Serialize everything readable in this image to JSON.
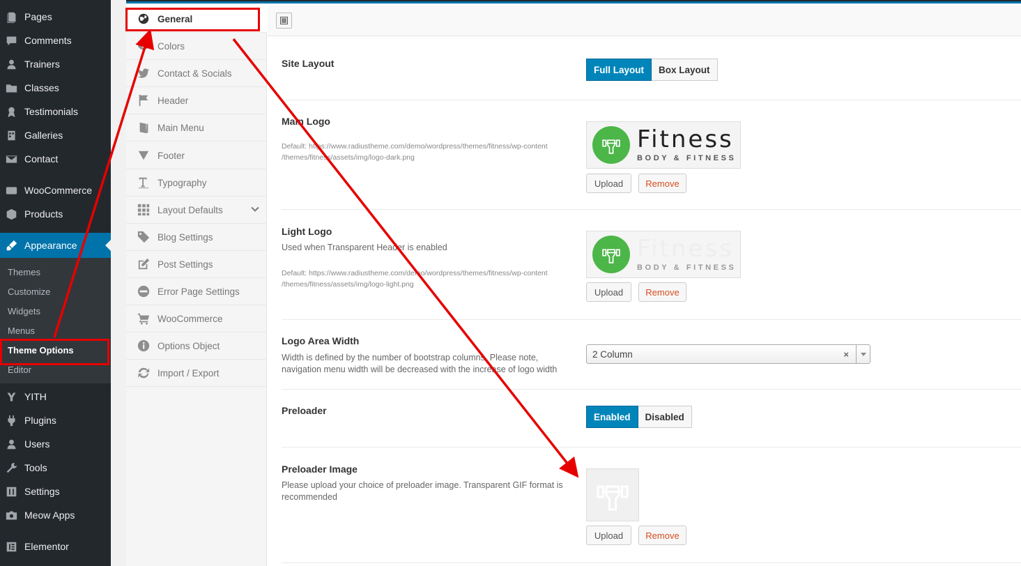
{
  "admin_menu": {
    "items": [
      {
        "label": "Pages",
        "icon": "pages-icon"
      },
      {
        "label": "Comments",
        "icon": "comments-icon"
      },
      {
        "label": "Trainers",
        "icon": "trainers-icon"
      },
      {
        "label": "Classes",
        "icon": "folder-icon"
      },
      {
        "label": "Testimonials",
        "icon": "award-icon"
      },
      {
        "label": "Galleries",
        "icon": "gallery-icon"
      },
      {
        "label": "Contact",
        "icon": "mail-icon"
      },
      {
        "label": "WooCommerce",
        "icon": "woocommerce-icon"
      },
      {
        "label": "Products",
        "icon": "box-icon"
      },
      {
        "label": "Appearance",
        "icon": "brush-icon"
      },
      {
        "label": "YITH",
        "icon": "yith-icon"
      },
      {
        "label": "Plugins",
        "icon": "plugin-icon"
      },
      {
        "label": "Users",
        "icon": "users-icon"
      },
      {
        "label": "Tools",
        "icon": "wrench-icon"
      },
      {
        "label": "Settings",
        "icon": "settings-icon"
      },
      {
        "label": "Meow Apps",
        "icon": "camera-icon"
      },
      {
        "label": "Elementor",
        "icon": "elementor-icon"
      }
    ],
    "appearance_submenu": [
      "Themes",
      "Customize",
      "Widgets",
      "Menus",
      "Theme Options",
      "Editor"
    ],
    "current_item": "Appearance",
    "current_subitem": "Theme Options"
  },
  "options_nav": {
    "items": [
      {
        "label": "General",
        "icon": "globe-icon"
      },
      {
        "label": "Colors",
        "icon": "eye-icon"
      },
      {
        "label": "Contact & Socials",
        "icon": "twitter-icon"
      },
      {
        "label": "Header",
        "icon": "flag-icon"
      },
      {
        "label": "Main Menu",
        "icon": "book-icon"
      },
      {
        "label": "Footer",
        "icon": "triangle-down-icon"
      },
      {
        "label": "Typography",
        "icon": "text-icon"
      },
      {
        "label": "Layout Defaults",
        "icon": "grid-icon"
      },
      {
        "label": "Blog Settings",
        "icon": "tags-icon"
      },
      {
        "label": "Post Settings",
        "icon": "edit-icon"
      },
      {
        "label": "Error Page Settings",
        "icon": "minus-circle-icon"
      },
      {
        "label": "WooCommerce",
        "icon": "cart-icon"
      },
      {
        "label": "Options Object",
        "icon": "info-icon"
      },
      {
        "label": "Import / Export",
        "icon": "refresh-icon"
      }
    ],
    "active": "General"
  },
  "fields": {
    "site_layout": {
      "title": "Site Layout",
      "options": [
        "Full Layout",
        "Box Layout"
      ],
      "selected": "Full Layout"
    },
    "main_logo": {
      "title": "Main Logo",
      "desc_line1": "Default: https://www.radiustheme.com/demo/wordpress/themes/fitness/wp-content",
      "desc_line2": "/themes/fitness/assets/img/logo-dark.png",
      "logo_word": "Fitness",
      "logo_tagline": "BODY & FITNESS",
      "upload_label": "Upload",
      "remove_label": "Remove"
    },
    "light_logo": {
      "title": "Light Logo",
      "subtitle": "Used when Transparent Header is enabled",
      "desc_line1": "Default: https://www.radiustheme.com/demo/wordpress/themes/fitness/wp-content",
      "desc_line2": "/themes/fitness/assets/img/logo-light.png",
      "logo_word": "Fitness",
      "logo_tagline": "BODY & FITNESS",
      "upload_label": "Upload",
      "remove_label": "Remove"
    },
    "logo_area_width": {
      "title": "Logo Area Width",
      "subtitle_line1": "Width is defined by the number of bootstrap columns. Please note,",
      "subtitle_line2": "navigation menu width will be decreased with the increase of logo width",
      "value": "2 Column",
      "clear": "×"
    },
    "preloader": {
      "title": "Preloader",
      "options": [
        "Enabled",
        "Disabled"
      ],
      "selected": "Enabled"
    },
    "preloader_image": {
      "title": "Preloader Image",
      "subtitle_line1": "Please upload your choice of preloader image. Transparent GIF format is",
      "subtitle_line2": "recommended",
      "upload_label": "Upload",
      "remove_label": "Remove"
    }
  },
  "colors": {
    "admin_bg": "#23282d",
    "admin_sub_bg": "#32373c",
    "accent": "#0073aa",
    "button_on": "#0085ba",
    "annotation_red": "#e60000",
    "logo_green": "#4cb648"
  }
}
